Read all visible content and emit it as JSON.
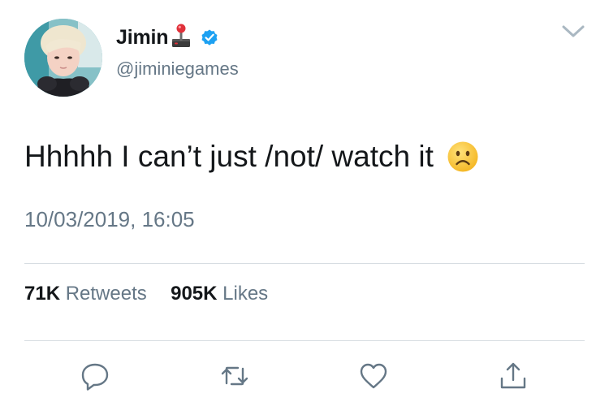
{
  "author": {
    "display_name": "Jimin",
    "handle": "@jiminiegames",
    "verified": true,
    "name_emoji": "joystick-icon"
  },
  "tweet": {
    "text": "Hhhhh I can’t just /not/ watch it",
    "emoji": "frowning-face-icon",
    "timestamp": "10/03/2019, 16:05"
  },
  "stats": {
    "retweets_count": "71K",
    "retweets_label": "Retweets",
    "likes_count": "905K",
    "likes_label": "Likes"
  },
  "actions": [
    {
      "icon": "reply-icon"
    },
    {
      "icon": "retweet-icon"
    },
    {
      "icon": "heart-icon"
    },
    {
      "icon": "share-icon"
    }
  ],
  "colors": {
    "verified_blue": "#1da1f2",
    "secondary_text": "#657786",
    "primary_text": "#14171a",
    "divider": "#d7dde2"
  }
}
